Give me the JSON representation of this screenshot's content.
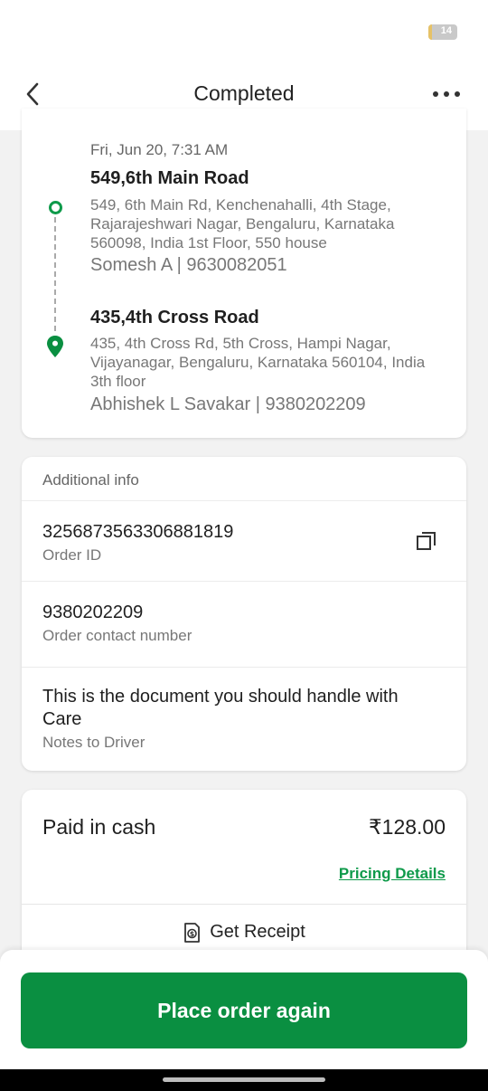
{
  "status_bar": {
    "battery_level": "14",
    "battery_fraction": 0.14
  },
  "header": {
    "title": "Completed"
  },
  "route": {
    "date": "Fri, Jun 20, 7:31 AM",
    "pickup": {
      "title": "549,6th Main Road",
      "address": "549, 6th Main Rd, Kenchenahalli, 4th Stage, Rajarajeshwari Nagar, Bengaluru, Karnataka 560098, India 1st Floor, 550 house",
      "contact": "Somesh A | 9630082051"
    },
    "dropoff": {
      "title": "435,4th Cross Road",
      "address": "435, 4th Cross Rd, 5th Cross, Hampi Nagar, Vijayanagar, Bengaluru, Karnataka 560104, India 3th floor",
      "contact": "Abhishek L Savakar | 9380202209"
    }
  },
  "additional_info": {
    "header": "Additional info",
    "order_id": {
      "value": "3256873563306881819",
      "label": "Order ID"
    },
    "contact": {
      "value": "9380202209",
      "label": "Order contact number"
    },
    "notes": {
      "value": "This is the document you should handle with Care",
      "label": "Notes to Driver"
    }
  },
  "payment": {
    "method_label": "Paid in cash",
    "amount": "₹128.00",
    "pricing_link": "Pricing Details",
    "receipt_label": "Get Receipt"
  },
  "cta": {
    "label": "Place order again"
  },
  "colors": {
    "brand_green": "#0a8f41",
    "link_green": "#0e9a4a"
  }
}
